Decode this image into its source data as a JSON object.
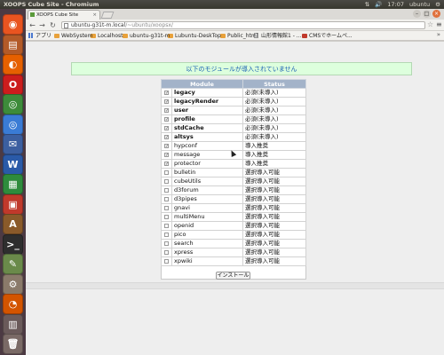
{
  "os_bar": {
    "title": "XOOPS Cube Site - Chromium",
    "tray": [
      "⇅",
      "🔊",
      "17:07",
      "ubuntu",
      "⚙"
    ]
  },
  "launcher": {
    "icons": [
      {
        "name": "dash-icon",
        "color": "#e95420",
        "glyph": "◉"
      },
      {
        "name": "files-icon",
        "color": "#b35a28",
        "glyph": "▤"
      },
      {
        "name": "firefox-icon",
        "color": "#e66000",
        "glyph": "◐"
      },
      {
        "name": "opera-icon",
        "color": "#cc1d1d",
        "glyph": "O"
      },
      {
        "name": "chrome-icon",
        "color": "#3d8b3a",
        "glyph": "◎"
      },
      {
        "name": "chromium-icon",
        "color": "#3a7bd5",
        "glyph": "◎"
      },
      {
        "name": "thunderbird-icon",
        "color": "#3c5fa0",
        "glyph": "✉"
      },
      {
        "name": "libreoffice-writer-icon",
        "color": "#2a5aa8",
        "glyph": "W"
      },
      {
        "name": "libreoffice-calc-icon",
        "color": "#2e8b3c",
        "glyph": "▦"
      },
      {
        "name": "libreoffice-impress-icon",
        "color": "#c0392b",
        "glyph": "▣"
      },
      {
        "name": "software-center-icon",
        "color": "#8a5a2a",
        "glyph": "A"
      },
      {
        "name": "terminal-icon",
        "color": "#2e2e2e",
        "glyph": ">_"
      },
      {
        "name": "text-editor-icon",
        "color": "#6a8a4a",
        "glyph": "✎"
      },
      {
        "name": "system-settings-icon",
        "color": "#8a7a6a",
        "glyph": "⚙"
      },
      {
        "name": "ubuntu-one-icon",
        "color": "#d35400",
        "glyph": "◔"
      },
      {
        "name": "workspaces-icon",
        "color": "#6a5a5a",
        "glyph": "▥"
      },
      {
        "name": "trash-icon",
        "color": "#7a6a66",
        "glyph": "🗑"
      }
    ]
  },
  "browser": {
    "tab_title": "XOOPS Cube Site",
    "url_host": "ubuntu-g31t-m.local",
    "url_path": "/~ubuntu/xoopsx/",
    "bookmarks": [
      {
        "label": "アプリ",
        "icon": "grid"
      },
      {
        "label": "WebSystem",
        "icon": "folder"
      },
      {
        "label": "Localhost",
        "icon": "folder"
      },
      {
        "label": "ubuntu-g31t-m",
        "icon": "folder"
      },
      {
        "label": "Lubuntu-DeskTop",
        "icon": "folder"
      },
      {
        "label": "Public_html",
        "icon": "folder"
      },
      {
        "label": "山形情報館1 - ...",
        "icon": "page"
      },
      {
        "label": "CMSでホームペ...",
        "icon": "cms"
      }
    ]
  },
  "page": {
    "notice": "以下のモジュールが導入されていません",
    "table": {
      "headers": [
        "Module",
        "Status"
      ],
      "rows": [
        {
          "module": "legacy",
          "status": "必須(未導入)",
          "checked": true,
          "required": true
        },
        {
          "module": "legacyRender",
          "status": "必須(未導入)",
          "checked": true,
          "required": true
        },
        {
          "module": "user",
          "status": "必須(未導入)",
          "checked": true,
          "required": true
        },
        {
          "module": "profile",
          "status": "必須(未導入)",
          "checked": true,
          "required": true
        },
        {
          "module": "stdCache",
          "status": "必須(未導入)",
          "checked": true,
          "required": true
        },
        {
          "module": "altsys",
          "status": "必須(未導入)",
          "checked": true,
          "required": true
        },
        {
          "module": "hypconf",
          "status": "導入推奨",
          "checked": true,
          "required": false
        },
        {
          "module": "message",
          "status": "導入推奨",
          "checked": true,
          "required": false
        },
        {
          "module": "protector",
          "status": "導入推奨",
          "checked": true,
          "required": false
        },
        {
          "module": "bulletin",
          "status": "選択導入可能",
          "checked": false,
          "required": false
        },
        {
          "module": "cubeUtils",
          "status": "選択導入可能",
          "checked": false,
          "required": false
        },
        {
          "module": "d3forum",
          "status": "選択導入可能",
          "checked": false,
          "required": false
        },
        {
          "module": "d3pipes",
          "status": "選択導入可能",
          "checked": false,
          "required": false
        },
        {
          "module": "gnavi",
          "status": "選択導入可能",
          "checked": false,
          "required": false
        },
        {
          "module": "multiMenu",
          "status": "選択導入可能",
          "checked": false,
          "required": false
        },
        {
          "module": "openid",
          "status": "選択導入可能",
          "checked": false,
          "required": false
        },
        {
          "module": "pico",
          "status": "選択導入可能",
          "checked": false,
          "required": false
        },
        {
          "module": "search",
          "status": "選択導入可能",
          "checked": false,
          "required": false
        },
        {
          "module": "xpress",
          "status": "選択導入可能",
          "checked": false,
          "required": false
        },
        {
          "module": "xpwiki",
          "status": "選択導入可能",
          "checked": false,
          "required": false
        }
      ]
    },
    "install_label": "インストール"
  }
}
